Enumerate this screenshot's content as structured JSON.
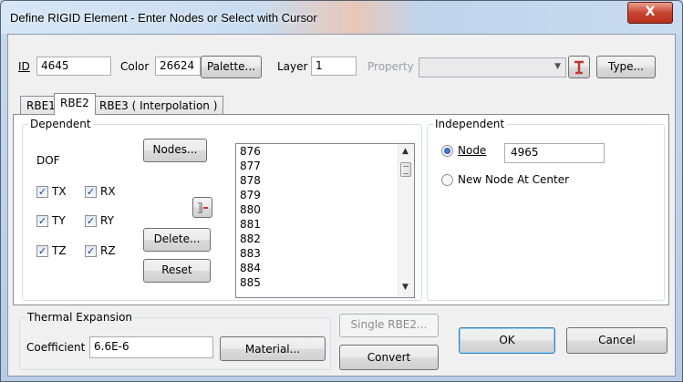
{
  "window": {
    "title": "Define RIGID Element - Enter Nodes or Select with Cursor",
    "close_label": "X"
  },
  "top": {
    "id_label": "ID",
    "id_value": "4645",
    "color_label": "Color",
    "color_value": "26624",
    "palette_label": "Palette...",
    "layer_label": "Layer",
    "layer_value": "1",
    "property_label": "Property",
    "property_value": "",
    "type_label": "Type..."
  },
  "tabs": [
    {
      "label": "RBE1"
    },
    {
      "label": "RBE2"
    },
    {
      "label": "RBE3 ( Interpolation )"
    }
  ],
  "dependent": {
    "title": "Dependent",
    "dof_label": "DOF",
    "checkboxes": [
      {
        "label": "TX",
        "checked": true
      },
      {
        "label": "RX",
        "checked": true
      },
      {
        "label": "TY",
        "checked": true
      },
      {
        "label": "RY",
        "checked": true
      },
      {
        "label": "TZ",
        "checked": true
      },
      {
        "label": "RZ",
        "checked": true
      }
    ],
    "nodes_button": "Nodes...",
    "delete_button": "Delete...",
    "reset_button": "Reset",
    "node_list": [
      "876",
      "877",
      "878",
      "879",
      "880",
      "881",
      "882",
      "883",
      "884",
      "885"
    ]
  },
  "independent": {
    "title": "Independent",
    "node_option": "Node",
    "node_value": "4965",
    "center_option": "New Node At Center"
  },
  "thermal": {
    "title": "Thermal Expansion",
    "coefficient_label": "Coefficient",
    "coefficient_value": "6.6E-6",
    "material_button": "Material..."
  },
  "buttons": {
    "single_rbe2": "Single RBE2...",
    "convert": "Convert",
    "ok": "OK",
    "cancel": "Cancel"
  }
}
